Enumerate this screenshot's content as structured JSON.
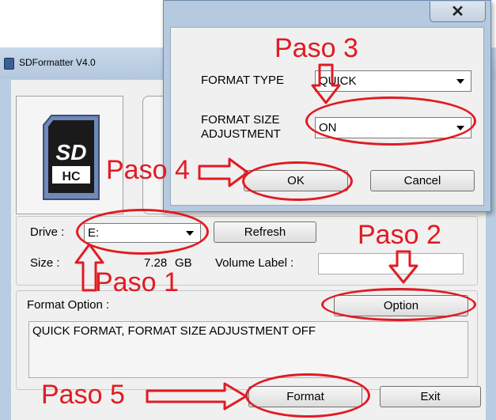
{
  "main_window": {
    "title": "SDFormatter V4.0",
    "drive_label": "Drive :",
    "drive_value": "E:",
    "refresh_label": "Refresh",
    "size_label": "Size :",
    "size_value": "7.28",
    "size_unit": "GB",
    "volume_label": "Volume Label :",
    "volume_value": "",
    "format_option_label": "Format Option :",
    "option_button": "Option",
    "format_option_text": "QUICK FORMAT, FORMAT SIZE ADJUSTMENT OFF",
    "format_button": "Format",
    "exit_button": "Exit",
    "sd_logo_text": "SD",
    "hc_logo_text": "HC"
  },
  "dialog": {
    "close_glyph": "✕",
    "format_type_label": "FORMAT TYPE",
    "format_type_value": "QUICK",
    "format_size_label_1": "FORMAT SIZE",
    "format_size_label_2": "ADJUSTMENT",
    "format_size_value": "ON",
    "ok_button": "OK",
    "cancel_button": "Cancel"
  },
  "annotations": {
    "paso1": "Paso 1",
    "paso2": "Paso 2",
    "paso3": "Paso 3",
    "paso4": "Paso 4",
    "paso5": "Paso 5",
    "color": "#e11b22"
  }
}
